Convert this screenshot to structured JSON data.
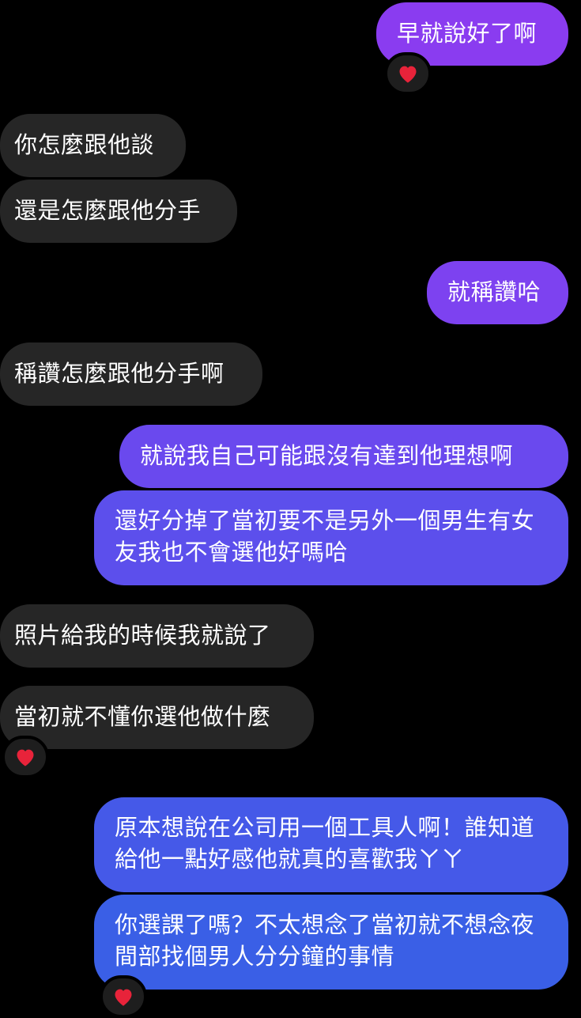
{
  "colors": {
    "received_bubble": "#262626",
    "sent_bubble_top": "#7b3ff2",
    "sent_bubble_bottom": "#3a5fe0",
    "heart": "#e8233a"
  },
  "messages": [
    {
      "id": "m1",
      "direction": "sent",
      "text": "早就說好了啊",
      "reaction": "heart"
    },
    {
      "id": "m2",
      "direction": "received",
      "text": "你怎麼跟他談"
    },
    {
      "id": "m3",
      "direction": "received",
      "text": "還是怎麼跟他分手"
    },
    {
      "id": "m4",
      "direction": "sent",
      "text": "就稱讚哈"
    },
    {
      "id": "m5",
      "direction": "received",
      "text": "稱讚怎麼跟他分手啊"
    },
    {
      "id": "m6",
      "direction": "sent",
      "text": "就說我自己可能跟沒有達到他理想啊"
    },
    {
      "id": "m7",
      "direction": "sent",
      "text": "還好分掉了當初要不是另外一個男生有女友我也不會選他好嗎哈"
    },
    {
      "id": "m8",
      "direction": "received",
      "text": "照片給我的時候我就說了"
    },
    {
      "id": "m9",
      "direction": "received",
      "text": "當初就不懂你選他做什麼",
      "reaction": "heart"
    },
    {
      "id": "m10",
      "direction": "sent",
      "text": "原本想說在公司用一個工具人啊！誰知道給他一點好感他就真的喜歡我ㄚㄚ"
    },
    {
      "id": "m11",
      "direction": "sent",
      "text": "你選課了嗎？不太想念了當初就不想念夜間部找個男人分分鐘的事情",
      "reaction": "heart"
    }
  ]
}
